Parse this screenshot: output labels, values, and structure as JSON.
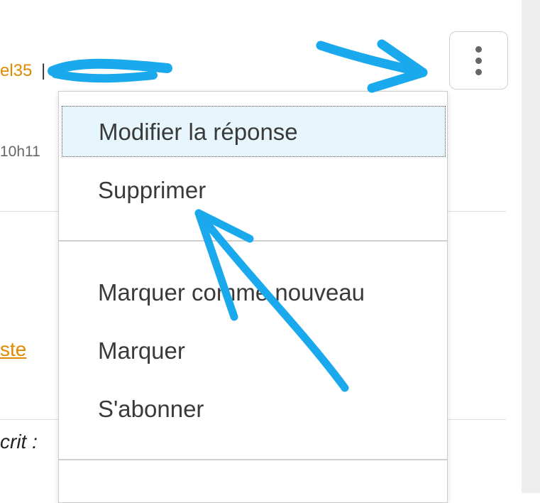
{
  "post": {
    "author_fragment": "el35",
    "author_separator": "|",
    "timestamp_fragment": "10h11",
    "link_fragment": "ste",
    "quote_fragment": "crit :"
  },
  "options_button": {
    "icon": "vertical-ellipsis-icon"
  },
  "menu": {
    "items": [
      {
        "label": "Modifier la réponse",
        "highlighted": true
      },
      {
        "label": "Supprimer"
      },
      {
        "label": "Marquer comme nouveau"
      },
      {
        "label": "Marquer"
      },
      {
        "label": "S'abonner"
      }
    ]
  },
  "annotations": {
    "color": "#1aa9ec",
    "redaction_color": "#1aa9ec",
    "arrows": [
      "arrow-to-options-button",
      "arrow-to-supprimer"
    ]
  },
  "colors": {
    "link": "#e08a00",
    "highlight_bg": "#e6f6fc",
    "border": "#cccccc"
  }
}
